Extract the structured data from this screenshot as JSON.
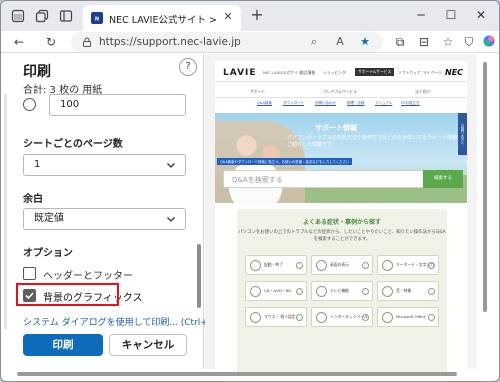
{
  "browser": {
    "tab_title": "NEC LAVIE公式サイト > サービス&サ",
    "url": "https://support.nec-lavie.jp"
  },
  "print": {
    "title": "印刷",
    "summary": "合計: 3 枚の 用紙",
    "help": "?",
    "pages_value": "100",
    "pages_per_sheet_label": "シートごとのページ数",
    "pages_per_sheet_value": "1",
    "margins_label": "余白",
    "margins_value": "既定値",
    "options_label": "オプション",
    "headers_footers_label": "ヘッダーとフッター",
    "background_graphics_label": "背景のグラフィックス",
    "system_dialog_link": "システム ダイアログを使用して印刷... (Ctrl+Shift+P)",
    "print_button": "印刷",
    "cancel_button": "キャンセル",
    "headers_footers_checked": false,
    "background_graphics_checked": true
  },
  "preview": {
    "logo": "LAVIE",
    "logo_sub": "NEC LAVIE公式サイト",
    "nav": [
      "製品情報",
      "ショッピング",
      "サポート&サービス",
      "ソフトウェア",
      "マイページ"
    ],
    "brand": "NEC",
    "subnav": [
      "サポート",
      "プレミアムサービス",
      "法人向け"
    ],
    "links": [
      "Q&A検索",
      "ダウンロード",
      "お問い合わせ",
      "修理・点検",
      "マニュアル",
      "PCお役立ち"
    ],
    "hero_title": "サポート情報",
    "hero_text": "パソコンのトラブルの対処方法や操作方法などのお手伝いするサポート情報をご紹介した情報です。",
    "hero_badge": "Q&A検索やダウンロード検索に役立つ、お使いの型番・品名などを入力してください",
    "search_placeholder": "Q&Aを検索する",
    "search_button": "検索する",
    "side_tab": "お困りの方へ",
    "faq_title": "よくある症状・事例から探す",
    "faq_desc": "パソコンをお使いの上でのトラブルなどの症状から、したいことやりたいこと、知りたい操作法からQ&Aを検索することができます。",
    "faq_items": [
      "起動・終了",
      "画面の表示",
      "キーボード・文字入力",
      "CD・DVD・BD",
      "テレビ機能",
      "音・映像",
      "マウス・ 個人設定",
      "インターネットメール",
      "Microsoft Office"
    ]
  }
}
